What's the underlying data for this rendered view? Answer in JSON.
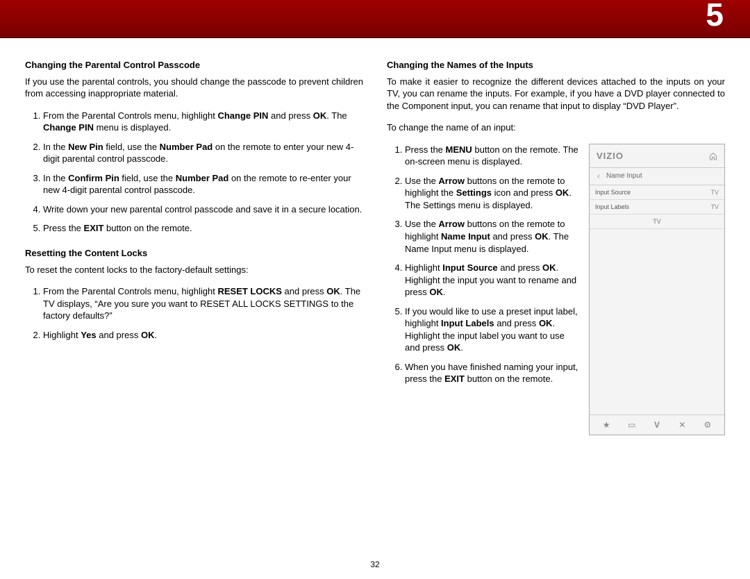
{
  "chapter_number": "5",
  "page_number": "32",
  "left": {
    "section1_title": "Changing the Parental Control Passcode",
    "section1_intro": "If you use the parental controls, you should change the passcode to prevent children from accessing inappropriate material.",
    "steps1": {
      "s1_a": "From the Parental Controls menu, highlight ",
      "s1_b": "Change PIN",
      "s1_c": " and press ",
      "s1_d": "OK",
      "s1_e": ". The ",
      "s1_f": "Change PIN",
      "s1_g": " menu is displayed.",
      "s2_a": "In the ",
      "s2_b": "New Pin",
      "s2_c": " field, use the ",
      "s2_d": "Number Pad",
      "s2_e": " on the remote to enter your new 4-digit parental control passcode.",
      "s3_a": "In the ",
      "s3_b": "Confirm Pin",
      "s3_c": " field, use the ",
      "s3_d": "Number Pad",
      "s3_e": " on the remote to re-enter your new 4-digit parental control passcode.",
      "s4": "Write down your new parental control passcode and save it in a secure location.",
      "s5_a": "Press the ",
      "s5_b": "EXIT",
      "s5_c": " button on the remote."
    },
    "section2_title": "Resetting the Content Locks",
    "section2_intro": "To reset the content locks to the factory-default settings:",
    "steps2": {
      "s1_a": "From the Parental Controls menu, highlight ",
      "s1_b": "RESET LOCKS",
      "s1_c": " and press ",
      "s1_d": "OK",
      "s1_e": ". The TV displays, “Are you sure you want to RESET ALL LOCKS SETTINGS to the factory defaults?”",
      "s2_a": "Highlight ",
      "s2_b": "Yes",
      "s2_c": " and press ",
      "s2_d": "OK",
      "s2_e": "."
    }
  },
  "right": {
    "section_title": "Changing the Names of the Inputs",
    "intro": "To make it easier to recognize the different devices attached to the inputs on your TV, you can rename the inputs. For example, if you have a DVD player connected to the Component input, you can rename that input to display “DVD Player”.",
    "lead": "To change the name of an input:",
    "steps": {
      "s1_a": "Press the ",
      "s1_b": "MENU",
      "s1_c": " button on the remote. The on-screen menu is displayed.",
      "s2_a": "Use the ",
      "s2_b": "Arrow",
      "s2_c": " buttons on the remote to highlight the ",
      "s2_d": "Settings",
      "s2_e": " icon and press ",
      "s2_f": "OK",
      "s2_g": ". The Settings menu is displayed.",
      "s3_a": "Use the ",
      "s3_b": "Arrow",
      "s3_c": " buttons on the remote to highlight ",
      "s3_d": "Name Input",
      "s3_e": " and press ",
      "s3_f": "OK",
      "s3_g": ". The Name Input menu is displayed.",
      "s4_a": "Highlight ",
      "s4_b": "Input Source",
      "s4_c": " and press ",
      "s4_d": "OK",
      "s4_e": ". Highlight the input you want to rename and press ",
      "s4_f": "OK",
      "s4_g": ".",
      "s5_a": "If you would like to use a preset input label, highlight ",
      "s5_b": "Input Labels",
      "s5_c": " and press ",
      "s5_d": "OK",
      "s5_e": ". Highlight the input label you want to use and press ",
      "s5_f": "OK",
      "s5_g": ".",
      "s6_a": "When you have finished naming your input, press the ",
      "s6_b": "EXIT",
      "s6_c": " button on the remote."
    }
  },
  "tv_panel": {
    "logo": "VIZIO",
    "crumb": "Name Input",
    "row1_label": "Input Source",
    "row1_value": "TV",
    "row2_label": "Input Labels",
    "row2_value": "TV",
    "row3_center": "TV",
    "footer": {
      "i1": "★",
      "i2": "▭",
      "i3": "V",
      "i4": "✕",
      "i5": "⚙"
    }
  }
}
